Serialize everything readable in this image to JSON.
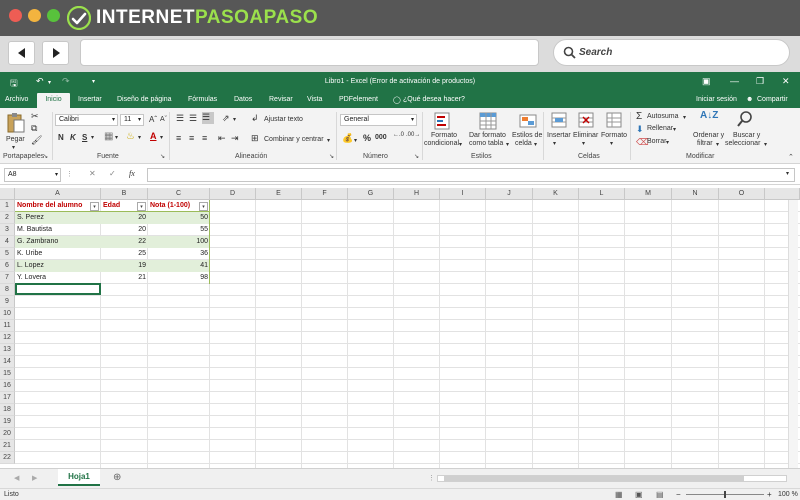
{
  "browser": {
    "brand_white_1": "INTERNET",
    "brand_green": "PASOAPASO",
    "search_label": "Search"
  },
  "window": {
    "title": "Libro1 - Excel (Error de activación de productos)"
  },
  "tabs": [
    "Archivo",
    "Inicio",
    "Insertar",
    "Diseño de página",
    "Fórmulas",
    "Datos",
    "Revisar",
    "Vista",
    "PDFelement"
  ],
  "tell_me": "¿Qué desea hacer?",
  "account": {
    "sign_in": "Iniciar sesión",
    "share": "Compartir"
  },
  "ribbon": {
    "paste": "Pegar",
    "font_name": "Calibri",
    "font_size": "11",
    "bold": "N",
    "italic": "K",
    "underline": "S",
    "wrap_text": "Ajustar texto",
    "merge_center": "Combinar y centrar",
    "number_format": "General",
    "percent": "%",
    "thousands": "000",
    "cond_format_1": "Formato",
    "cond_format_2": "condicional",
    "table_format_1": "Dar formato",
    "table_format_2": "como tabla",
    "cell_styles_1": "Estilos de",
    "cell_styles_2": "celda",
    "insert": "Insertar",
    "delete": "Eliminar",
    "format": "Formato",
    "autosum": "Autosuma",
    "fill": "Rellenar",
    "clear": "Borrar",
    "sort_1": "Ordenar y",
    "sort_2": "filtrar",
    "find_1": "Buscar y",
    "find_2": "seleccionar",
    "groups": {
      "clipboard": "Portapapeles",
      "font": "Fuente",
      "alignment": "Alineación",
      "number": "Número",
      "styles": "Estilos",
      "cells": "Celdas",
      "editing": "Modificar"
    }
  },
  "formula_bar": {
    "name_box": "A8",
    "fx": "fx"
  },
  "columns": [
    "A",
    "B",
    "C",
    "D",
    "E",
    "F",
    "G",
    "H",
    "I",
    "J",
    "K",
    "L",
    "M",
    "N",
    "O"
  ],
  "rows": [
    "1",
    "2",
    "3",
    "4",
    "5",
    "6",
    "7",
    "8",
    "9",
    "10",
    "11",
    "12",
    "13",
    "14",
    "15",
    "16",
    "17",
    "18",
    "19",
    "20",
    "21",
    "22"
  ],
  "table": {
    "headers": [
      "Nombre del alumno",
      "Edad",
      "Nota (1-100)"
    ],
    "data": [
      [
        "S. Perez",
        "20",
        "50"
      ],
      [
        "M. Bautista",
        "20",
        "55"
      ],
      [
        "G. Zambrano",
        "22",
        "100"
      ],
      [
        "K. Uribe",
        "25",
        "36"
      ],
      [
        "L. Lopez",
        "19",
        "41"
      ],
      [
        "Y. Lovera",
        "21",
        "98"
      ]
    ]
  },
  "sheet_tab": "Hoja1",
  "status": {
    "ready": "Listo",
    "zoom": "100 %"
  },
  "colors": {
    "excel_green": "#217346",
    "header_red": "#c00000",
    "band_green": "#e2efda",
    "brand_green": "#9be14c"
  }
}
